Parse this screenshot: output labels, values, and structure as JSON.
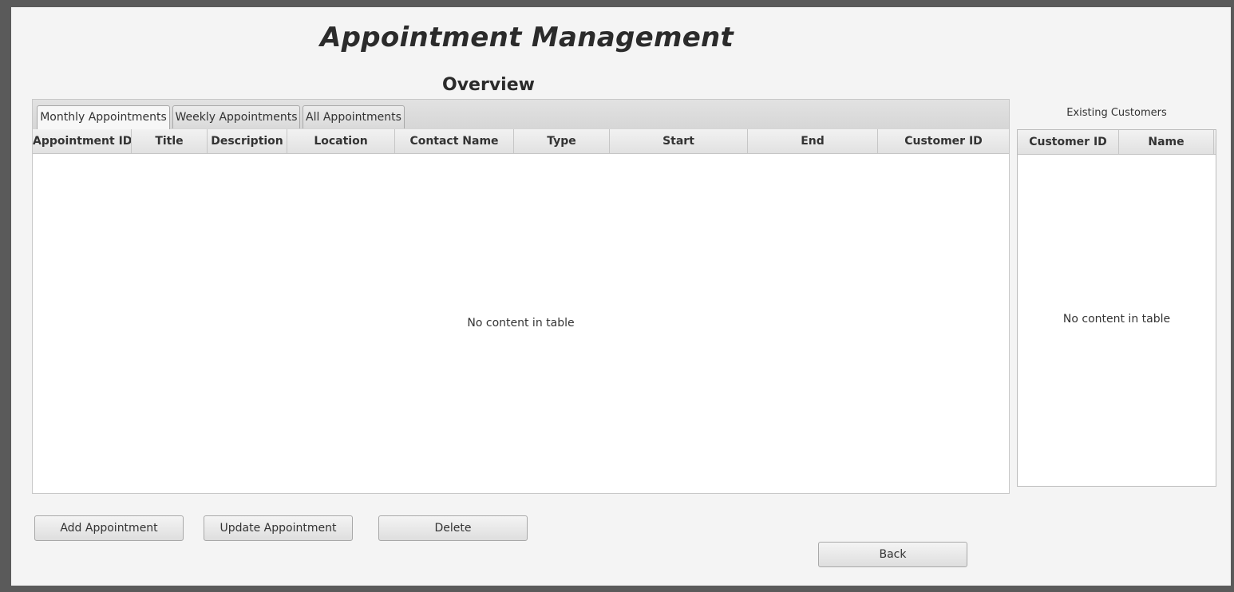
{
  "header": {
    "title": "Appointment Management",
    "subtitle": "Overview"
  },
  "tabs": [
    {
      "label": "Monthly Appointments",
      "selected": true
    },
    {
      "label": "Weekly Appointments",
      "selected": false
    },
    {
      "label": "All Appointments",
      "selected": false
    }
  ],
  "appointments_table": {
    "columns": [
      "Appointment ID",
      "Title",
      "Description",
      "Location",
      "Contact Name",
      "Type",
      "Start",
      "End",
      "Customer ID"
    ],
    "rows": [],
    "placeholder": "No content in table"
  },
  "customers": {
    "label": "Existing Customers",
    "columns": [
      "Customer ID",
      "Name"
    ],
    "rows": [],
    "placeholder": "No content in table"
  },
  "buttons": {
    "add": "Add Appointment",
    "update": "Update Appointment",
    "delete": "Delete",
    "back": "Back"
  }
}
